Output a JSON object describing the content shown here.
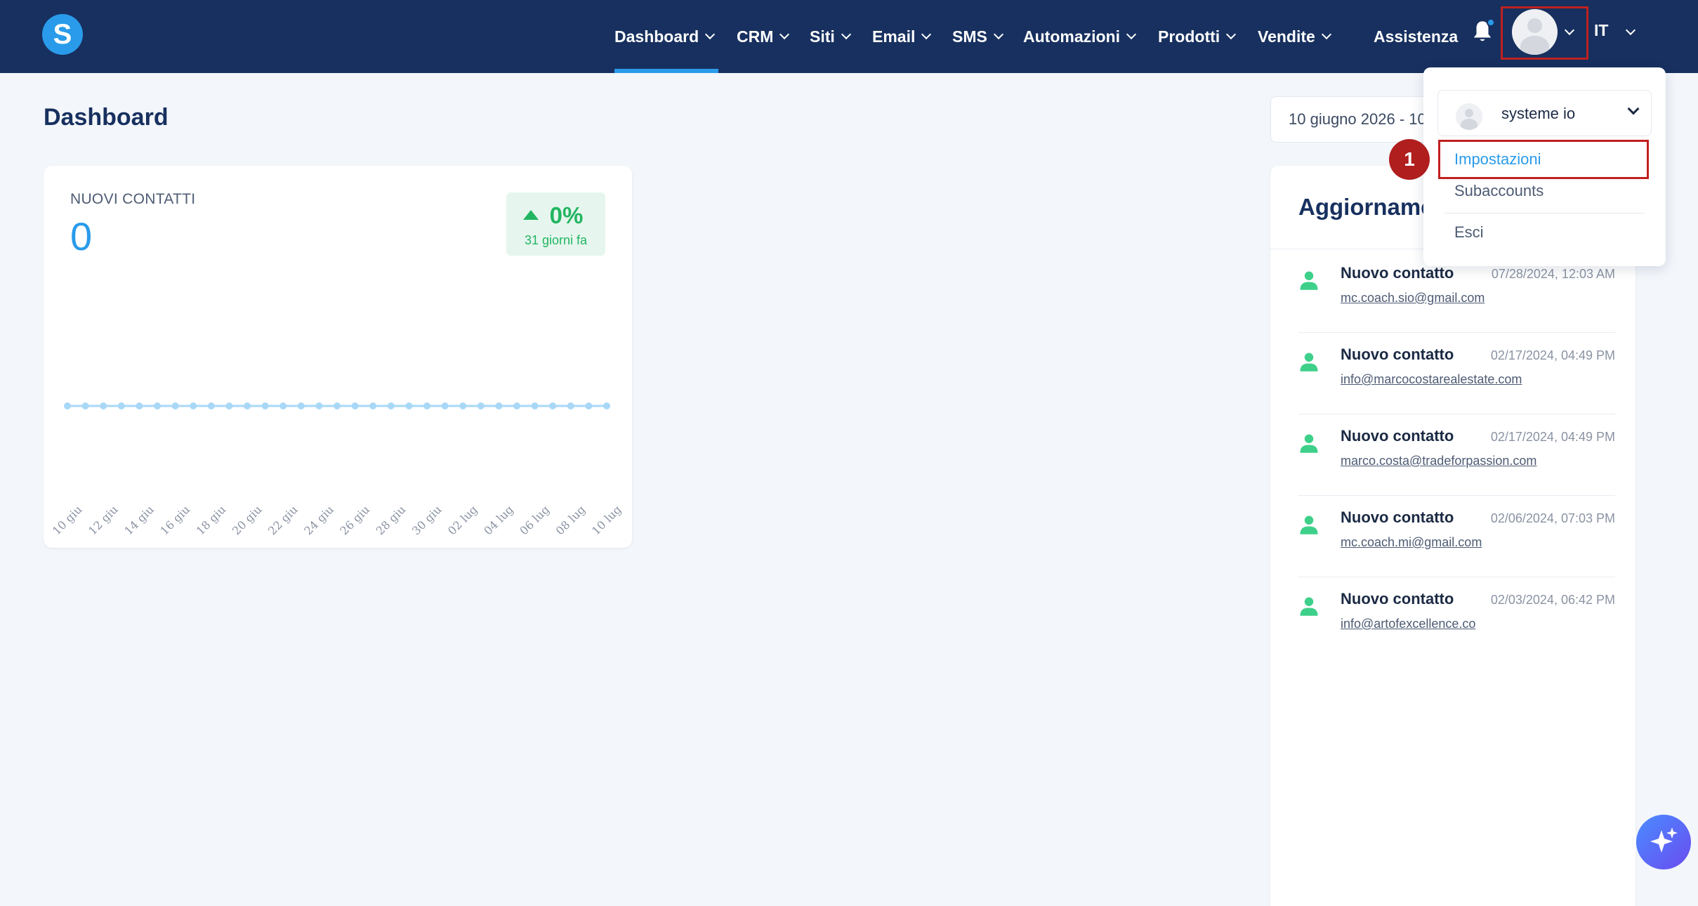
{
  "nav": {
    "items": [
      {
        "label": "Dashboard",
        "active": true,
        "has_menu": true
      },
      {
        "label": "CRM",
        "has_menu": true
      },
      {
        "label": "Siti",
        "has_menu": true
      },
      {
        "label": "Email",
        "has_menu": true
      },
      {
        "label": "SMS",
        "has_menu": true
      },
      {
        "label": "Automazioni",
        "has_menu": true
      },
      {
        "label": "Prodotti",
        "has_menu": true
      },
      {
        "label": "Vendite",
        "has_menu": true
      }
    ],
    "assistance_label": "Assistenza",
    "language": "IT",
    "logo_letter": "S",
    "accent_color": "#2a9bea",
    "bar_color": "#17305f"
  },
  "page": {
    "title": "Dashboard",
    "date_range": "10 giugno 2026 - 10 luglio 2026"
  },
  "contacts_card": {
    "label": "NUOVI CONTATTI",
    "value": "0",
    "change_pct": "0%",
    "change_period": "31 giorni fa",
    "change_color": "#22b561"
  },
  "chart_data": {
    "type": "line",
    "x": [
      "10 giu",
      "11 giu",
      "12 giu",
      "13 giu",
      "14 giu",
      "15 giu",
      "16 giu",
      "17 giu",
      "18 giu",
      "19 giu",
      "20 giu",
      "21 giu",
      "22 giu",
      "23 giu",
      "24 giu",
      "25 giu",
      "26 giu",
      "27 giu",
      "28 giu",
      "29 giu",
      "30 giu",
      "01 lug",
      "02 lug",
      "03 lug",
      "04 lug",
      "05 lug",
      "06 lug",
      "07 lug",
      "08 lug",
      "09 lug",
      "10 lug"
    ],
    "tick_labels": [
      "10 giu",
      "12 giu",
      "14 giu",
      "16 giu",
      "18 giu",
      "20 giu",
      "22 giu",
      "24 giu",
      "26 giu",
      "28 giu",
      "30 giu",
      "02 lug",
      "04 lug",
      "06 lug",
      "08 lug",
      "10 lug"
    ],
    "series": [
      {
        "values": [
          0,
          0,
          0,
          0,
          0,
          0,
          0,
          0,
          0,
          0,
          0,
          0,
          0,
          0,
          0,
          0,
          0,
          0,
          0,
          0,
          0,
          0,
          0,
          0,
          0,
          0,
          0,
          0,
          0,
          0,
          0
        ]
      }
    ],
    "line_color": "#a9d8f7",
    "grid": false,
    "legend": "none"
  },
  "updates": {
    "title": "Aggiornamenti",
    "items": [
      {
        "title": "Nuovo contatto",
        "time": "07/28/2024, 12:03 AM",
        "email": "mc.coach.sio@gmail.com"
      },
      {
        "title": "Nuovo contatto",
        "time": "02/17/2024, 04:49 PM",
        "email": "info@marcocostarealestate.com"
      },
      {
        "title": "Nuovo contatto",
        "time": "02/17/2024, 04:49 PM",
        "email": "marco.costa@tradeforpassion.com"
      },
      {
        "title": "Nuovo contatto",
        "time": "02/06/2024, 07:03 PM",
        "email": "mc.coach.mi@gmail.com"
      },
      {
        "title": "Nuovo contatto",
        "time": "02/03/2024, 06:42 PM",
        "email": "info@artofexcellence.co"
      }
    ],
    "icon_color": "#3ed08a"
  },
  "account_menu": {
    "account_name": "systeme io",
    "items": [
      "Impostazioni",
      "Subaccounts",
      "Esci"
    ],
    "highlight_color": "#c0201f",
    "step_number": "1"
  }
}
